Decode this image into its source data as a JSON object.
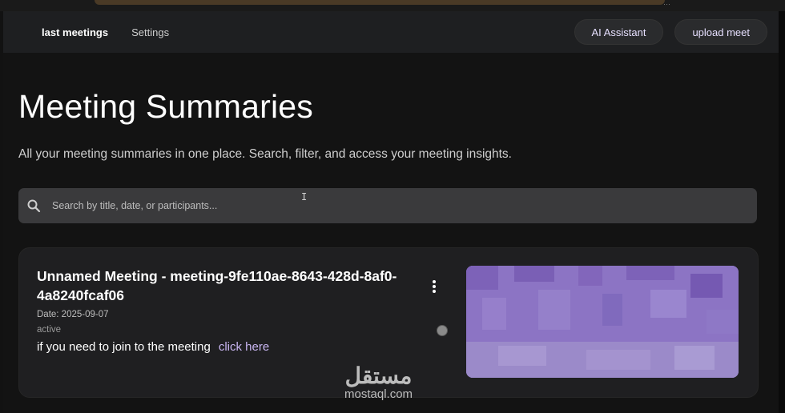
{
  "nav": {
    "links": [
      {
        "label": "last meetings",
        "active": true
      },
      {
        "label": "Settings",
        "active": false
      }
    ],
    "buttons": {
      "ai_assistant": "AI Assistant",
      "upload_meet": "upload meet"
    }
  },
  "header": {
    "title": "Meeting Summaries",
    "subtitle": "All your meeting summaries in one place. Search, filter, and access your meeting insights."
  },
  "search": {
    "placeholder": "Search by title, date, or participants...",
    "value": "",
    "icon": "search-icon"
  },
  "meetings": [
    {
      "title": "Unnamed Meeting - meeting-9fe110ae-8643-428d-8af0-4a8240fcaf06",
      "date": "Date: 2025-09-07",
      "status": "active",
      "join_text": "if you need to join to the meeting",
      "join_link": "click here",
      "menu_icon": "more-vertical-icon"
    }
  ],
  "watermark": {
    "arabic": "مستقل",
    "latin": "mostaql.com"
  },
  "colors": {
    "background": "#121212",
    "navbar": "#1e1f21",
    "card": "#1f1f21",
    "search": "#3a3a3c",
    "accent": "#c9b6f2",
    "thumbnail": "#8a72c2"
  }
}
